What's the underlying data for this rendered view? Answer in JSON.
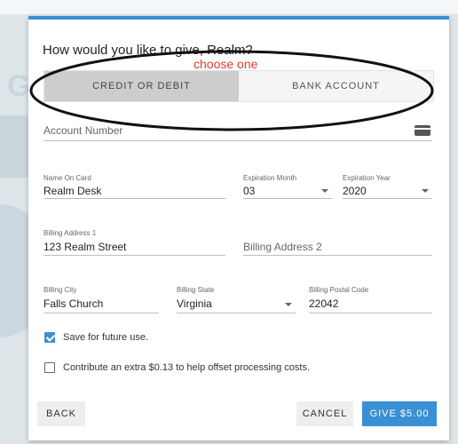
{
  "page": {
    "background_logo_fragment": "Gi"
  },
  "modal": {
    "title": "How would you like to give, Realm?",
    "annotation_hint": "choose one",
    "tabs": [
      {
        "label": "CREDIT OR DEBIT",
        "active": true
      },
      {
        "label": "BANK ACCOUNT",
        "active": false
      }
    ],
    "account_number": {
      "placeholder": "Account Number",
      "icon": "credit-card-icon"
    },
    "name_on_card": {
      "label": "Name On Card",
      "value": "Realm Desk"
    },
    "expiration_month": {
      "label": "Expiration Month",
      "value": "03"
    },
    "expiration_year": {
      "label": "Expiration Year",
      "value": "2020"
    },
    "billing_address_1": {
      "label": "Billing Address 1",
      "value": "123 Realm Street"
    },
    "billing_address_2": {
      "placeholder": "Billing Address 2"
    },
    "billing_city": {
      "label": "Billing City",
      "value": "Falls Church"
    },
    "billing_state": {
      "label": "Billing State",
      "value": "Virginia"
    },
    "billing_postal_code": {
      "label": "Billing Postal Code",
      "value": "22042"
    },
    "save_future": {
      "label": "Save for future use.",
      "checked": true
    },
    "contribute_extra": {
      "label": "Contribute an extra $0.13 to help offset processing costs.",
      "checked": false
    },
    "buttons": {
      "back": "BACK",
      "cancel": "CANCEL",
      "give": "GIVE $5.00"
    }
  },
  "colors": {
    "accent": "#3b8fd3",
    "annotation_red": "#e03b2e",
    "tab_active_bg": "#cdcdcd"
  }
}
